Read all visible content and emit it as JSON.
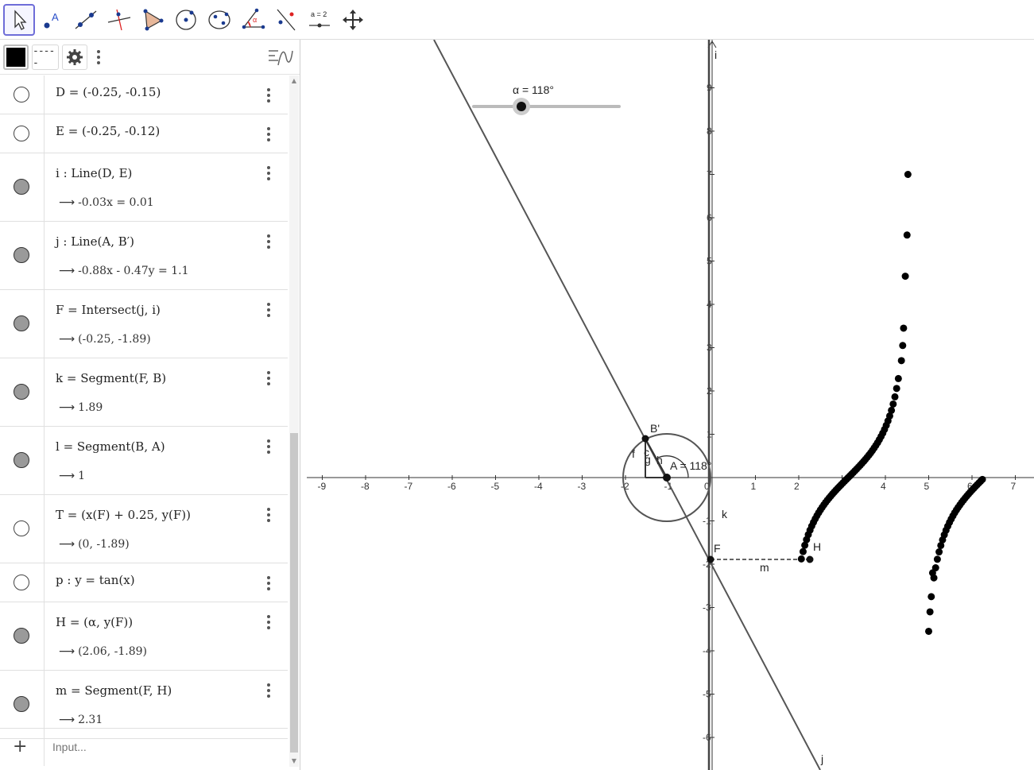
{
  "toolbar": {
    "tools": [
      {
        "name": "move-tool",
        "active": true
      },
      {
        "name": "point-tool"
      },
      {
        "name": "line-tool"
      },
      {
        "name": "perpendicular-line-tool"
      },
      {
        "name": "polygon-tool"
      },
      {
        "name": "circle-center-point-tool"
      },
      {
        "name": "conic-tool"
      },
      {
        "name": "angle-tool"
      },
      {
        "name": "reflect-tool"
      },
      {
        "name": "slider-tool",
        "label": "a = 2"
      },
      {
        "name": "move-graphics-view-tool"
      }
    ]
  },
  "algebra": {
    "rows": [
      {
        "def": "D  =  (-0.25,  -0.15)",
        "visible": false
      },
      {
        "def": "E  =  (-0.25,  -0.12)",
        "visible": false
      },
      {
        "def": "i : Line(D, E)",
        "value": "-0.03x  =  0.01",
        "visible": true
      },
      {
        "def": "j : Line(A, B′)",
        "value": "-0.88x  -  0.47y  =  1.1",
        "visible": true
      },
      {
        "def": "F  =  Intersect(j, i)",
        "value": "(-0.25,  -1.89)",
        "visible": true
      },
      {
        "def": "k  =  Segment(F, B)",
        "value": "1.89",
        "visible": true
      },
      {
        "def": "l  =  Segment(B, A)",
        "value": "1",
        "visible": true
      },
      {
        "def": "T  =  (x(F) + 0.25, y(F))",
        "value": "(0,  -1.89)",
        "visible": false
      },
      {
        "def": "p :  y  =  tan(x)",
        "visible": false
      },
      {
        "def": "H  =  (α, y(F))",
        "value": "(2.06,  -1.89)",
        "visible": true
      },
      {
        "def": "m  =  Segment(F, H)",
        "value": "2.31",
        "visible": true
      }
    ],
    "input_placeholder": "Input...",
    "add_symbol": "+",
    "arrow": "⟶",
    "dash_label": "-----"
  },
  "graphics": {
    "slider_label": "α = 118°",
    "slider_value_deg": 118,
    "angle_label": "A = 118°",
    "x_ticks": [
      "-9",
      "-8",
      "-7",
      "-6",
      "-5",
      "-4",
      "-3",
      "-2",
      "-1",
      "0",
      "1",
      "2",
      "3",
      "4",
      "5",
      "6",
      "7"
    ],
    "y_ticks": [
      "9",
      "8",
      "7",
      "6",
      "5",
      "4",
      "3",
      "2",
      "1",
      "-1",
      "-2",
      "-3",
      "-4",
      "-5",
      "-6"
    ],
    "labels": {
      "B'": "B'",
      "F": "F",
      "H": "H",
      "j": "j",
      "i": "i",
      "k": "k",
      "m": "m",
      "f": "f",
      "g": "g",
      "h": "h",
      "c": "c",
      "A": "A"
    }
  }
}
